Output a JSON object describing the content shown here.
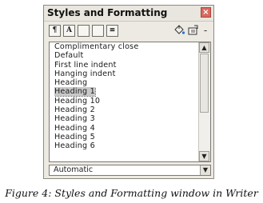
{
  "window": {
    "title": "Styles and Formatting",
    "close_glyph": "×"
  },
  "toolbar": {
    "buttons": [
      {
        "name": "paragraph-styles-icon",
        "glyph": "¶"
      },
      {
        "name": "character-styles-icon",
        "glyph": "A"
      },
      {
        "name": "frame-styles-icon",
        "glyph": ""
      },
      {
        "name": "page-styles-icon",
        "glyph": ""
      },
      {
        "name": "list-styles-icon",
        "glyph": "≡"
      }
    ],
    "fill_format_icon": "paint-bucket-icon",
    "new_style_icon": "new-style-icon",
    "dropdown_glyph": "-"
  },
  "list": {
    "items": [
      "Complimentary close",
      "Default",
      "First line indent",
      "Hanging indent",
      "Heading",
      "Heading 1",
      "Heading 10",
      "Heading 2",
      "Heading 3",
      "Heading 4",
      "Heading 5",
      "Heading 6"
    ],
    "selected_index": 5
  },
  "filter": {
    "value": "Automatic"
  },
  "caption": "Figure 4: Styles and Formatting window in Writer",
  "colors": {
    "window_bg": "#eceae3",
    "close_button": "#d9695f",
    "selection": "#c8c8c8"
  }
}
